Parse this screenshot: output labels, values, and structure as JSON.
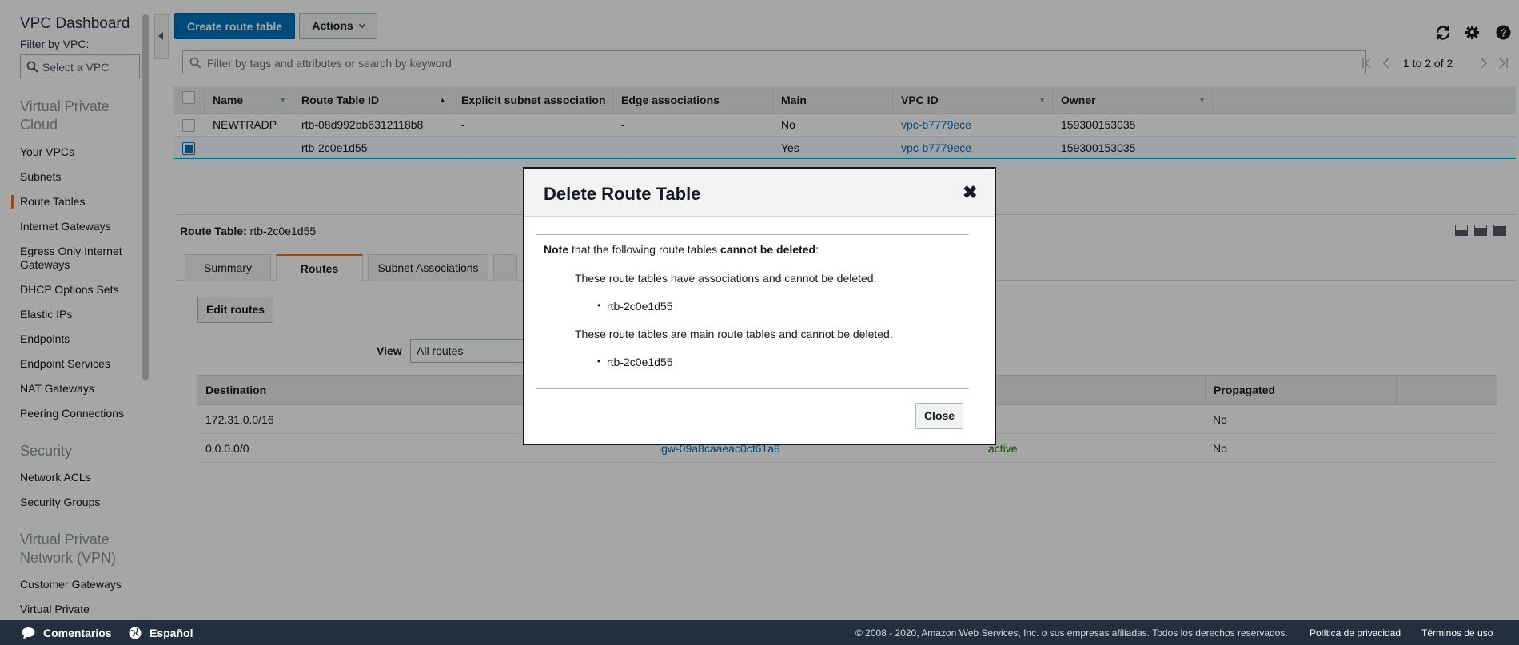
{
  "sidebar": {
    "title": "VPC Dashboard",
    "filter_label": "Filter by VPC:",
    "select_placeholder": "Select a VPC",
    "section_vpc": "Virtual Private Cloud",
    "vpc_items": [
      "Your VPCs",
      "Subnets",
      "Route Tables",
      "Internet Gateways",
      "Egress Only Internet Gateways",
      "DHCP Options Sets",
      "Elastic IPs",
      "Endpoints",
      "Endpoint Services",
      "NAT Gateways",
      "Peering Connections"
    ],
    "section_security": "Security",
    "security_items": [
      "Network ACLs",
      "Security Groups"
    ],
    "section_vpn": "Virtual Private Network (VPN)",
    "vpn_items": [
      "Customer Gateways",
      "Virtual Private"
    ],
    "active_item": "Route Tables"
  },
  "toolbar": {
    "create_label": "Create route table",
    "actions_label": "Actions",
    "search_placeholder": "Filter by tags and attributes or search by keyword",
    "pager_text": "1 to 2 of 2"
  },
  "grid": {
    "columns": [
      "Name",
      "Route Table ID",
      "Explicit subnet association",
      "Edge associations",
      "Main",
      "VPC ID",
      "Owner"
    ],
    "rows": [
      {
        "name": "NEWTRADP",
        "route_table_id": "rtb-08d992bb6312118b8",
        "explicit": "-",
        "edge": "-",
        "main": "No",
        "vpc_id": "vpc-b7779ece",
        "owner": "159300153035",
        "selected": false
      },
      {
        "name": "",
        "route_table_id": "rtb-2c0e1d55",
        "explicit": "-",
        "edge": "-",
        "main": "Yes",
        "vpc_id": "vpc-b7779ece",
        "owner": "159300153035",
        "selected": true
      }
    ]
  },
  "detail": {
    "label": "Route Table:",
    "value": "rtb-2c0e1d55",
    "tabs": [
      "Summary",
      "Routes",
      "Subnet Associations"
    ],
    "active_tab": "Routes",
    "edit_label": "Edit routes",
    "view_label": "View",
    "view_value": "All routes",
    "routes_columns": [
      "Destination",
      "Propagated"
    ],
    "routes": [
      {
        "destination": "172.31.0.0/16",
        "target": "",
        "status": "",
        "propagated": "No"
      },
      {
        "destination": "0.0.0.0/0",
        "target": "igw-09a8caaeac0cf61a8",
        "status": "active",
        "propagated": "No"
      }
    ]
  },
  "modal": {
    "title": "Delete Route Table",
    "note_bold": "Note",
    "note_mid": " that the following route tables ",
    "note_bold2": "cannot be deleted",
    "note_end": ":",
    "msg_assoc": "These route tables have associations and cannot be deleted.",
    "assoc_items": [
      "rtb-2c0e1d55"
    ],
    "msg_main": "These route tables are main route tables and cannot be deleted.",
    "main_items": [
      "rtb-2c0e1d55"
    ],
    "close_label": "Close"
  },
  "footer": {
    "feedback": "Comentarios",
    "language": "Español",
    "copyright": "© 2008 - 2020, Amazon Web Services, Inc. o sus empresas afiliadas. Todos los derechos reservados.",
    "privacy": "Política de privacidad",
    "terms": "Términos de uso"
  },
  "colors": {
    "primary": "#0073bb",
    "accent": "#ec7211",
    "footer_bg": "#232f3e",
    "status_active": "#1d8102"
  },
  "icons": [
    "search-icon",
    "refresh-icon",
    "gear-icon",
    "help-icon",
    "close-icon",
    "chevron-down-icon",
    "speech-bubble-icon",
    "globe-icon"
  ]
}
